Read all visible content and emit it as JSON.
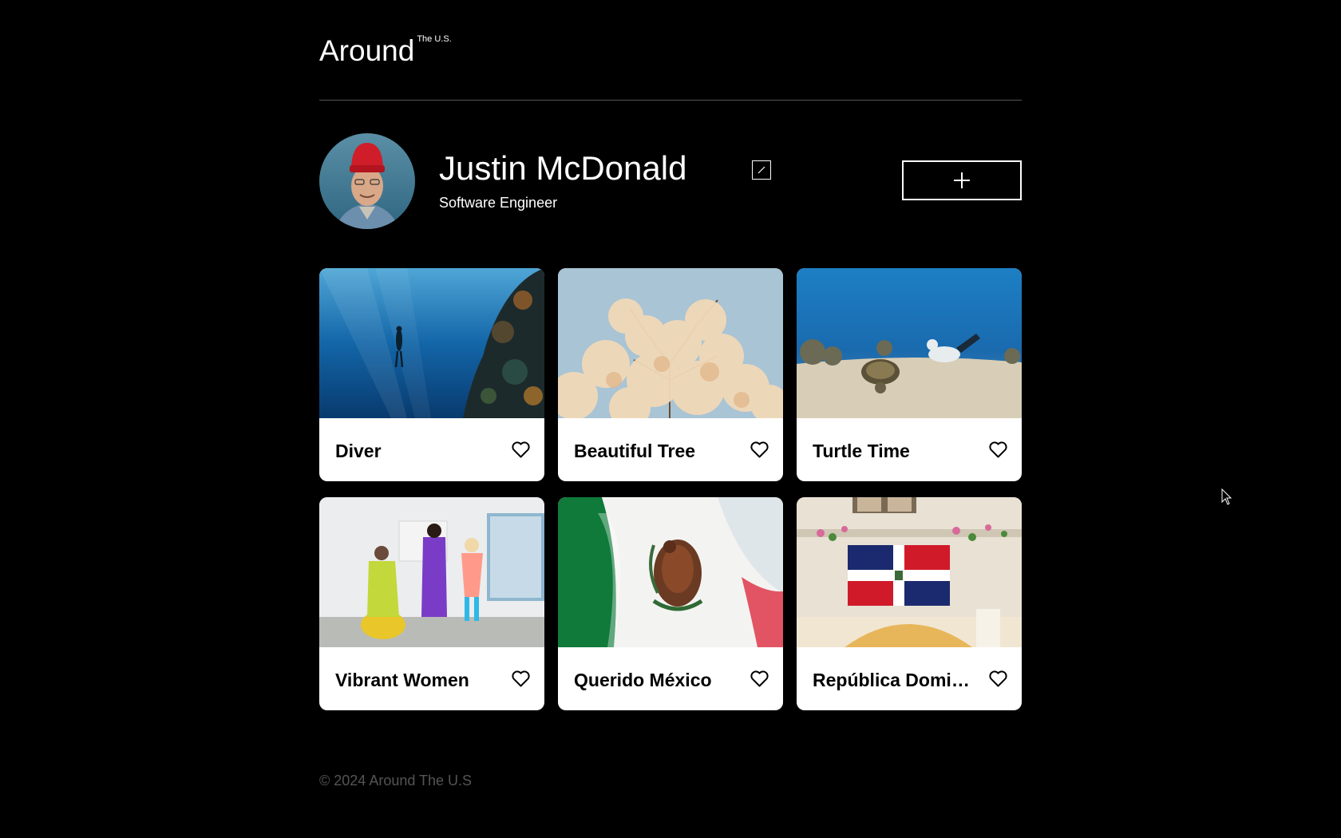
{
  "header": {
    "logo_main": "Around",
    "logo_sup": "The U.S."
  },
  "profile": {
    "name": "Justin McDonald",
    "job": "Software Engineer",
    "edit_icon": "pencil-icon",
    "add_icon": "plus-icon"
  },
  "cards": [
    {
      "title": "Diver",
      "image": "diver-underwater-photo",
      "liked": false
    },
    {
      "title": "Beautiful Tree",
      "image": "blossom-tree-photo",
      "liked": false
    },
    {
      "title": "Turtle Time",
      "image": "turtle-snorkeler-photo",
      "liked": false
    },
    {
      "title": "Vibrant Women",
      "image": "women-colorful-suits-photo",
      "liked": false
    },
    {
      "title": "Querido México",
      "image": "mexican-flag-photo",
      "liked": false
    },
    {
      "title": "República Dominicana",
      "image": "dominican-flag-photo",
      "liked": false
    }
  ],
  "footer": {
    "copyright": "© 2024 Around The U.S"
  },
  "colors": {
    "background": "#000000",
    "text": "#ffffff",
    "footer_text": "#545454",
    "card_bg": "#ffffff"
  }
}
